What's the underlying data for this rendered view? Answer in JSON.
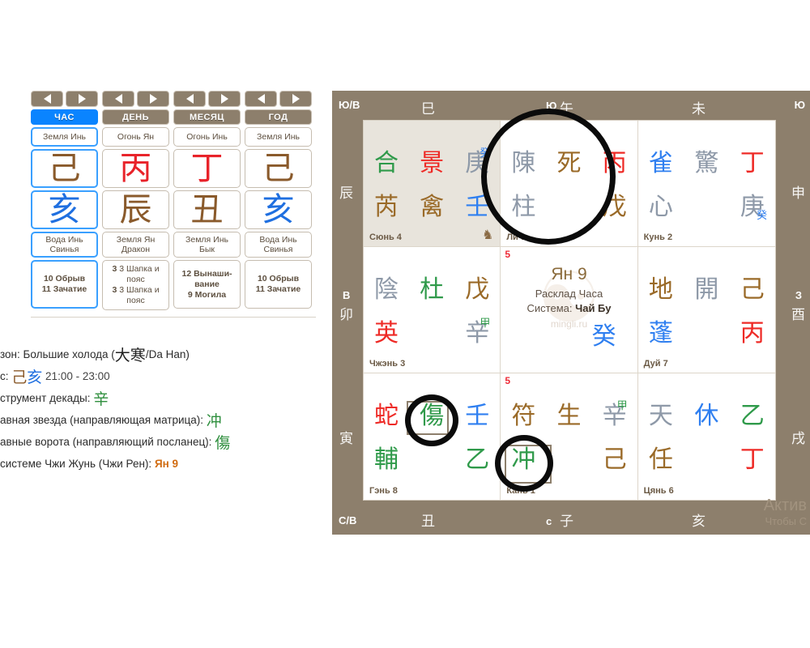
{
  "left_panel": {
    "nav_arrow_prev": "◀",
    "nav_arrow_next": "▶",
    "pillars": [
      {
        "title": "ЧАС",
        "active": true,
        "element_top": "Земля Инь",
        "stem": "己",
        "stem_color": "#8a5a2b",
        "branch": "亥",
        "branch_color": "#1f6fe0",
        "element_bottom": "Вода Инь\nСвинья",
        "stages": [
          "10 Обрыв",
          "11 Зачатие"
        ]
      },
      {
        "title": "ДЕНЬ",
        "active": false,
        "element_top": "Огонь Ян",
        "stem": "丙",
        "stem_color": "#e8232a",
        "branch": "辰",
        "branch_color": "#8a5a2b",
        "element_bottom": "Земля Ян\nДракон",
        "stages": [
          "3 Шапка и пояс",
          "3 Шапка и пояс"
        ]
      },
      {
        "title": "МЕСЯЦ",
        "active": false,
        "element_top": "Огонь Инь",
        "stem": "丁",
        "stem_color": "#e8232a",
        "branch": "丑",
        "branch_color": "#8a5a2b",
        "element_bottom": "Земля Инь\nБык",
        "stages": [
          "12 Вынаши-вание",
          "9 Могила"
        ]
      },
      {
        "title": "ГОД",
        "active": false,
        "element_top": "Земля Инь",
        "stem": "己",
        "stem_color": "#8a5a2b",
        "branch": "亥",
        "branch_color": "#1f6fe0",
        "element_bottom": "Вода Инь\nСвинья",
        "stages": [
          "10 Обрыв",
          "11 Зачатие"
        ]
      }
    ],
    "info": {
      "season_label": "зон: Большие холода (",
      "season_han": "大寒",
      "season_tail": "/Da Han)",
      "hour_label": "с: ",
      "hour_stem": "己",
      "hour_branch": "亥",
      "hour_range": " 21:00 - 23:00",
      "decade_label": "струмент декады: ",
      "decade_han": "辛",
      "star_label": "авная звезда (направляющая матрица): ",
      "star_han": "冲",
      "gate_label": "авные ворота (направляющий посланец): ",
      "gate_han": "傷",
      "zhi_label": "системе Чжи Жунь (Чжи Рен): ",
      "zhi_value": "Ян 9"
    }
  },
  "chart": {
    "edges": {
      "top_left_corner": "Ю/В",
      "top_right_corner": "Ю",
      "bottom_left_corner": "С/В",
      "top_branch_1": "巳",
      "top_dir_mid": "Ю",
      "top_branch_2": "午",
      "top_branch_3": "未",
      "left_branch_1": "辰",
      "left_dir_mid": "В",
      "left_branch_2": "卯",
      "left_branch_3": "寅",
      "right_branch_1": "申",
      "right_dir_mid": "З",
      "right_branch_2": "酉",
      "right_branch_3": "戌",
      "bottom_branch_1": "丑",
      "bottom_dir_mid": "с",
      "bottom_branch_2": "子",
      "bottom_branch_3": "亥"
    },
    "center": {
      "title": "Ян 9",
      "sub1": "Расклад Часа",
      "sub2_prefix": "Система: ",
      "sub2_value": "Чай Бу",
      "watermark": "mingli.ru",
      "stem": "癸",
      "corner_num": "5"
    },
    "cells": [
      {
        "palace": "Сюнь 4",
        "shaded": true,
        "corner_num": "",
        "row1": [
          {
            "ch": "合",
            "color": "c-green"
          },
          {
            "ch": "景",
            "color": "c-red"
          },
          {
            "ch": "庚",
            "color": "c-gray",
            "sup": "癸",
            "sup_color": "c-blue",
            "sup_pos": "tr"
          }
        ],
        "row2": [
          {
            "ch": "芮",
            "color": "c-brown"
          },
          {
            "ch": "禽",
            "color": "c-brown"
          },
          {
            "ch": "壬",
            "color": "c-blue"
          }
        ],
        "horse": "♞"
      },
      {
        "palace": "Ли 9",
        "shaded": false,
        "corner_num": "",
        "row1": [
          {
            "ch": "陳",
            "color": "c-gray"
          },
          {
            "ch": "死",
            "color": "c-brown"
          },
          {
            "ch": "丙",
            "color": "c-red"
          }
        ],
        "row2": [
          {
            "ch": "柱",
            "color": "c-gray"
          },
          {
            "ch": "",
            "color": ""
          },
          {
            "ch": "戊",
            "color": "c-brown"
          }
        ],
        "horse": ""
      },
      {
        "palace": "Кунь 2",
        "shaded": false,
        "corner_num": "",
        "row1": [
          {
            "ch": "雀",
            "color": "c-blue"
          },
          {
            "ch": "驚",
            "color": "c-gray"
          },
          {
            "ch": "丁",
            "color": "c-red"
          }
        ],
        "row2": [
          {
            "ch": "心",
            "color": "c-gray"
          },
          {
            "ch": "",
            "color": ""
          },
          {
            "ch": "庚",
            "color": "c-gray",
            "sup": "癸",
            "sup_color": "c-blue",
            "sup_pos": "br"
          }
        ],
        "horse": ""
      },
      {
        "palace": "Чжэнь 3",
        "shaded": false,
        "corner_num": "",
        "row1": [
          {
            "ch": "陰",
            "color": "c-gray"
          },
          {
            "ch": "杜",
            "color": "c-green"
          },
          {
            "ch": "戊",
            "color": "c-brown"
          }
        ],
        "row2": [
          {
            "ch": "英",
            "color": "c-red"
          },
          {
            "ch": "",
            "color": ""
          },
          {
            "ch": "辛",
            "color": "c-gray",
            "sup": "甲",
            "sup_color": "c-green",
            "sup_pos": "tr"
          }
        ],
        "horse": ""
      },
      {
        "palace": "Дуй 7",
        "shaded": false,
        "corner_num": "",
        "row1": [
          {
            "ch": "地",
            "color": "c-brown"
          },
          {
            "ch": "開",
            "color": "c-gray"
          },
          {
            "ch": "己",
            "color": "c-brown"
          }
        ],
        "row2": [
          {
            "ch": "蓬",
            "color": "c-blue"
          },
          {
            "ch": "",
            "color": ""
          },
          {
            "ch": "丙",
            "color": "c-red"
          }
        ],
        "horse": ""
      },
      {
        "palace": "Гэнь 8",
        "shaded": false,
        "corner_num": "",
        "row1": [
          {
            "ch": "蛇",
            "color": "c-red"
          },
          {
            "ch": "傷",
            "color": "c-green"
          },
          {
            "ch": "壬",
            "color": "c-blue"
          }
        ],
        "row2": [
          {
            "ch": "輔",
            "color": "c-green"
          },
          {
            "ch": "",
            "color": ""
          },
          {
            "ch": "乙",
            "color": "c-green"
          }
        ],
        "horse": ""
      },
      {
        "palace": "Кань 1",
        "shaded": false,
        "corner_num": "5",
        "row1": [
          {
            "ch": "符",
            "color": "c-brown"
          },
          {
            "ch": "生",
            "color": "c-brown"
          },
          {
            "ch": "辛",
            "color": "c-gray",
            "sup": "甲",
            "sup_color": "c-green",
            "sup_pos": "tr"
          }
        ],
        "row2": [
          {
            "ch": "冲",
            "color": "c-green"
          },
          {
            "ch": "",
            "color": ""
          },
          {
            "ch": "己",
            "color": "c-brown"
          }
        ],
        "horse": ""
      },
      {
        "palace": "Цянь 6",
        "shaded": false,
        "corner_num": "",
        "row1": [
          {
            "ch": "天",
            "color": "c-gray"
          },
          {
            "ch": "休",
            "color": "c-blue"
          },
          {
            "ch": "乙",
            "color": "c-green"
          }
        ],
        "row2": [
          {
            "ch": "任",
            "color": "c-brown"
          },
          {
            "ch": "",
            "color": ""
          },
          {
            "ch": "丁",
            "color": "c-red"
          }
        ],
        "horse": ""
      }
    ],
    "activation_watermark": {
      "line1": "Актив",
      "line2": "Чтобы  С"
    }
  }
}
